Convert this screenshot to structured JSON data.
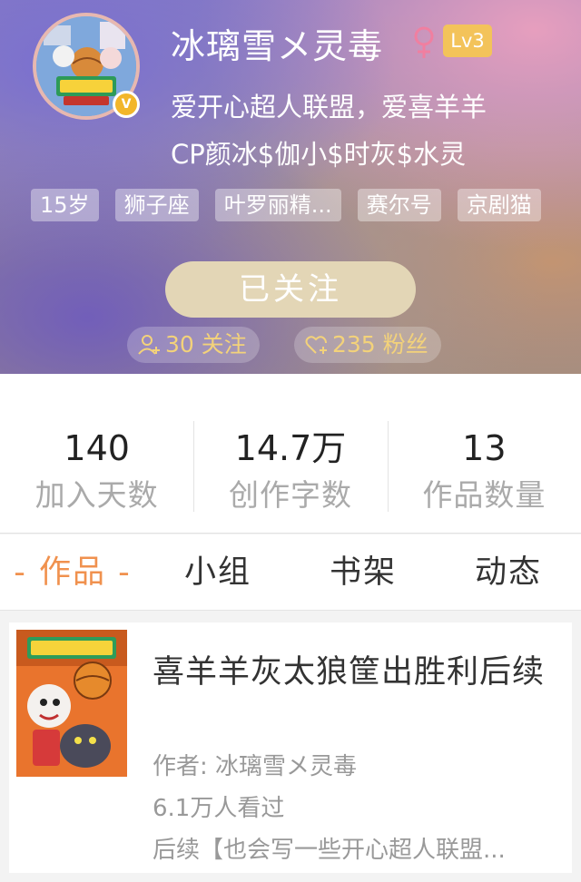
{
  "profile": {
    "username": "冰璃雪メ灵毒",
    "level": "Lv3",
    "verified_badge": "V",
    "bio_line1": "爱开心超人联盟，爱喜羊羊",
    "bio_line2": "CP颜冰$伽小$时灰$水灵",
    "gender_icon": "female-icon",
    "gender_color": "#f07fa0",
    "tags": [
      "15岁",
      "狮子座",
      "叶罗丽精...",
      "赛尔号",
      "京剧猫"
    ],
    "follow_button": "已关注",
    "following_count": "30 关注",
    "followers_count": "235 粉丝"
  },
  "stats": [
    {
      "value": "140",
      "label": "加入天数"
    },
    {
      "value": "14.7万",
      "label": "创作字数"
    },
    {
      "value": "13",
      "label": "作品数量"
    }
  ],
  "tabs": [
    {
      "label": "- 作品 -",
      "active": true
    },
    {
      "label": "小组",
      "active": false
    },
    {
      "label": "书架",
      "active": false
    },
    {
      "label": "动态",
      "active": false
    }
  ],
  "work": {
    "title": "喜羊羊灰太狼筐出胜利后续",
    "author": "作者: 冰璃雪メ灵毒",
    "views": "6.1万人看过",
    "description": "后续【也会写一些开心超人联盟..."
  },
  "colors": {
    "accent": "#f0914e",
    "level_badge": "#f3c35a",
    "follow_button": "#e3d6b6",
    "stat_pill_text": "#f3d27a"
  }
}
